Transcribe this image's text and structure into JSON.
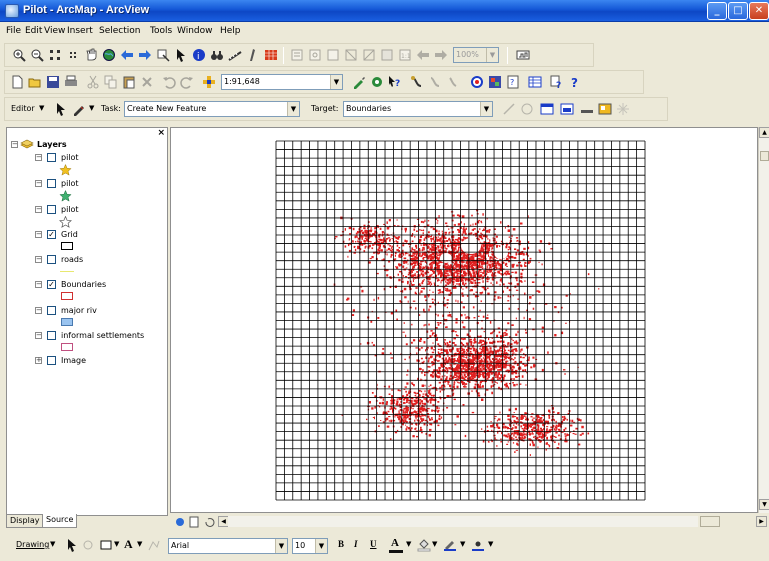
{
  "window": {
    "title": "Pilot - ArcMap - ArcView"
  },
  "menu": [
    "File",
    "Edit",
    "View",
    "Insert",
    "Selection",
    "Tools",
    "Window",
    "Help"
  ],
  "standard_toolbar": {
    "scale_value": "1:91,648"
  },
  "tools_toolbar": {
    "zoom_level": "100%"
  },
  "editor_toolbar": {
    "editor_label": "Editor",
    "task_label": "Task:",
    "task_value": "Create New Feature",
    "target_label": "Target:",
    "target_value": "Boundaries"
  },
  "toc": {
    "root_label": "Layers",
    "layers": [
      {
        "name": "pilot",
        "checked": false,
        "symbol": "star-yellow"
      },
      {
        "name": "pilot",
        "checked": false,
        "symbol": "star-green"
      },
      {
        "name": "pilot",
        "checked": false,
        "symbol": "star-outline"
      },
      {
        "name": "Grid",
        "checked": true,
        "symbol": "rect-outline"
      },
      {
        "name": "roads",
        "checked": false,
        "symbol": "line-yellow"
      },
      {
        "name": "Boundaries",
        "checked": true,
        "symbol": "rect-red-outline"
      },
      {
        "name": "major riv",
        "checked": false,
        "symbol": "rect-blue-fill"
      },
      {
        "name": "informal settlements",
        "checked": false,
        "symbol": "rect-pink-outline"
      },
      {
        "name": "Image",
        "checked": false,
        "symbol": "none"
      }
    ],
    "tabs": [
      "Display",
      "Source"
    ]
  },
  "drawing_toolbar": {
    "drawing_label": "Drawing",
    "font_name": "Arial",
    "font_size": "10",
    "bold": "B",
    "italic": "I",
    "underline": "U"
  },
  "colors": {
    "title_bar": "#1457d6",
    "grid_line": "#000000",
    "settlement_red": "#e02020",
    "panel_bg": "#ece9d8"
  }
}
